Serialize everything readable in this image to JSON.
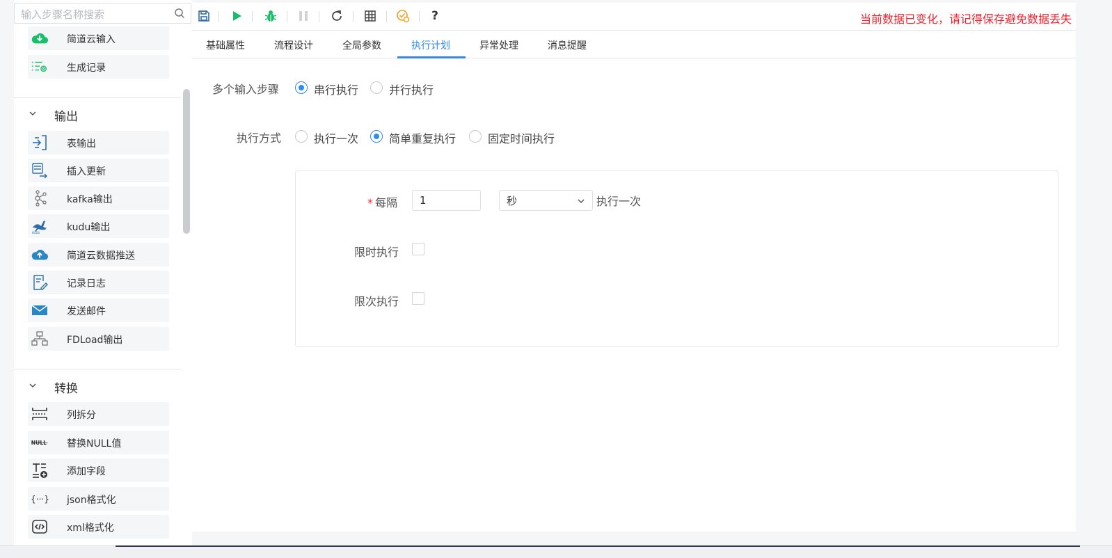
{
  "search": {
    "placeholder": "输入步骤名称搜索"
  },
  "sidebar": {
    "items_top": [
      {
        "label": "简道云输入",
        "icon": "cloud-download-icon"
      },
      {
        "label": "生成记录",
        "icon": "generate-records-icon"
      }
    ],
    "groups": [
      {
        "label": "输出",
        "items": [
          {
            "label": "表输出",
            "icon": "table-output-icon"
          },
          {
            "label": "插入更新",
            "icon": "insert-update-icon"
          },
          {
            "label": "kafka输出",
            "icon": "kafka-icon"
          },
          {
            "label": "kudu输出",
            "icon": "kudu-icon"
          },
          {
            "label": "简道云数据推送",
            "icon": "cloud-upload-icon"
          },
          {
            "label": "记录日志",
            "icon": "log-icon"
          },
          {
            "label": "发送邮件",
            "icon": "mail-icon"
          },
          {
            "label": "FDLoad输出",
            "icon": "fdload-icon"
          }
        ]
      },
      {
        "label": "转换",
        "items": [
          {
            "label": "列拆分",
            "icon": "column-split-icon"
          },
          {
            "label": "替换NULL值",
            "icon": "null-replace-icon",
            "icon_text": "NULL"
          },
          {
            "label": "添加字段",
            "icon": "add-field-icon"
          },
          {
            "label": "json格式化",
            "icon": "json-icon",
            "icon_text": "{···}"
          },
          {
            "label": "xml格式化",
            "icon": "xml-icon"
          }
        ]
      }
    ]
  },
  "toolbar": {
    "buttons": [
      "save-icon",
      "run-icon",
      "debug-icon",
      "pause-icon",
      "refresh-icon",
      "grid-icon",
      "settings-check-icon",
      "help-icon"
    ],
    "help_label": "?",
    "warning": "当前数据已变化，请记得保存避免数据丢失"
  },
  "tabs": [
    {
      "label": "基础属性",
      "active": false
    },
    {
      "label": "流程设计",
      "active": false
    },
    {
      "label": "全局参数",
      "active": false
    },
    {
      "label": "执行计划",
      "active": true
    },
    {
      "label": "异常处理",
      "active": false
    },
    {
      "label": "消息提醒",
      "active": false
    }
  ],
  "form": {
    "multi_input": {
      "label": "多个输入步骤",
      "options": [
        {
          "label": "串行执行",
          "checked": true
        },
        {
          "label": "并行执行",
          "checked": false
        }
      ]
    },
    "exec_mode": {
      "label": "执行方式",
      "options": [
        {
          "label": "执行一次",
          "checked": false
        },
        {
          "label": "简单重复执行",
          "checked": true
        },
        {
          "label": "固定时间执行",
          "checked": false
        }
      ]
    },
    "interval": {
      "required_mark": "*",
      "label": "每隔",
      "value": "1",
      "unit": "秒",
      "suffix": "执行一次"
    },
    "time_limit": {
      "label": "限时执行",
      "checked": false
    },
    "count_limit": {
      "label": "限次执行",
      "checked": false
    }
  },
  "colors": {
    "accent": "#2d8cf0",
    "warning": "#f5222d",
    "green": "#19be6b"
  }
}
